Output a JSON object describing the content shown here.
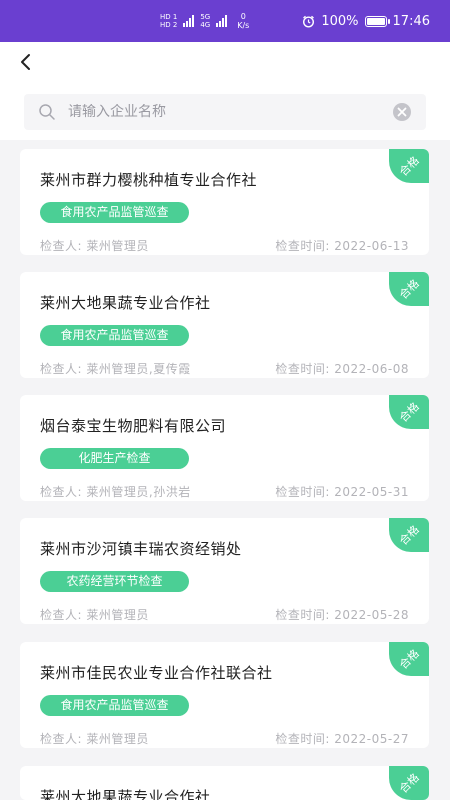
{
  "status_bar": {
    "hd1": "HD 1",
    "hd2": "HD 2",
    "net1": "4G",
    "net2": "5G",
    "speed_value": "0",
    "speed_unit": "K/s",
    "battery": "100%",
    "time": "17:46"
  },
  "search": {
    "placeholder": "请输入企业名称",
    "value": ""
  },
  "records": [
    {
      "company": "莱州市群力樱桃种植专业合作社",
      "type": "食用农产品监管巡查",
      "inspector_label": "检查人:",
      "inspector": "莱州管理员",
      "time_label": "检查时间:",
      "date": "2022-06-13",
      "status": "合格"
    },
    {
      "company": "莱州大地果蔬专业合作社",
      "type": "食用农产品监管巡查",
      "inspector_label": "检查人:",
      "inspector": "莱州管理员,夏传霞",
      "time_label": "检查时间:",
      "date": "2022-06-08",
      "status": "合格"
    },
    {
      "company": "烟台泰宝生物肥料有限公司",
      "type": "化肥生产检查",
      "inspector_label": "检查人:",
      "inspector": "莱州管理员,孙洪岩",
      "time_label": "检查时间:",
      "date": "2022-05-31",
      "status": "合格"
    },
    {
      "company": "莱州市沙河镇丰瑞农资经销处",
      "type": "农药经营环节检查",
      "inspector_label": "检查人:",
      "inspector": "莱州管理员",
      "time_label": "检查时间:",
      "date": "2022-05-28",
      "status": "合格"
    },
    {
      "company": "莱州市佳民农业专业合作社联合社",
      "type": "食用农产品监管巡查",
      "inspector_label": "检查人:",
      "inspector": "莱州管理员",
      "time_label": "检查时间:",
      "date": "2022-05-27",
      "status": "合格"
    },
    {
      "company": "莱州大地果蔬专业合作社",
      "type": "",
      "inspector_label": "",
      "inspector": "",
      "time_label": "",
      "date": "",
      "status": "合格"
    }
  ],
  "colors": {
    "status_bar": "#6a3fd0",
    "accent_green": "#4bcf95"
  }
}
